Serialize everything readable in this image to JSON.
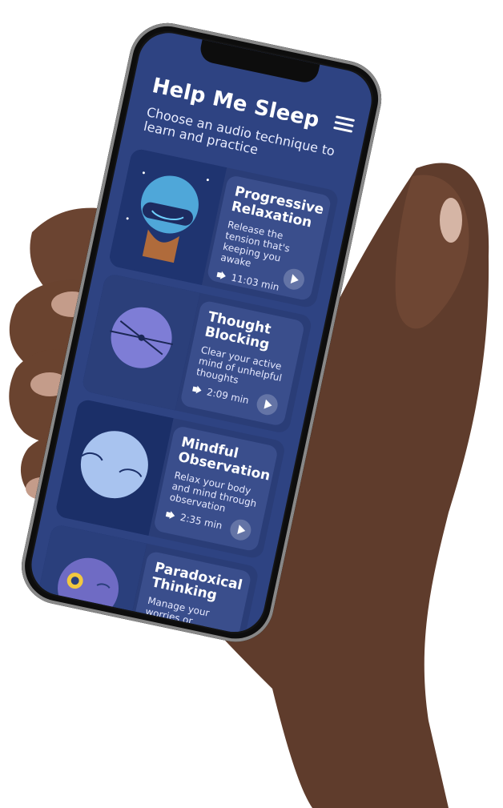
{
  "app": {
    "title": "Help Me Sleep",
    "subtitle": "Choose an audio technique to learn and practice",
    "menu_icon": "hamburger-menu-icon"
  },
  "techniques": [
    {
      "title": "Progressive Relaxation",
      "desc": "Release the tension that's keeping you awake",
      "duration": "11:03 min"
    },
    {
      "title": "Thought Blocking",
      "desc": "Clear your active mind of unhelpful thoughts",
      "duration": "2:09 min"
    },
    {
      "title": "Mindful Observation",
      "desc": "Relax your body and mind through observation",
      "duration": "2:35 min"
    },
    {
      "title": "Paradoxical Thinking",
      "desc": "Manage your worries or"
    }
  ],
  "colors": {
    "screen_bg": "#2e4382",
    "card_bg": "#2a3d77",
    "content_bg": "#3a4e8c",
    "play_bg": "#6474a6",
    "skin_dark": "#5a3a2a",
    "skin_mid": "#6b4431",
    "skin_light": "#7a4e39"
  }
}
